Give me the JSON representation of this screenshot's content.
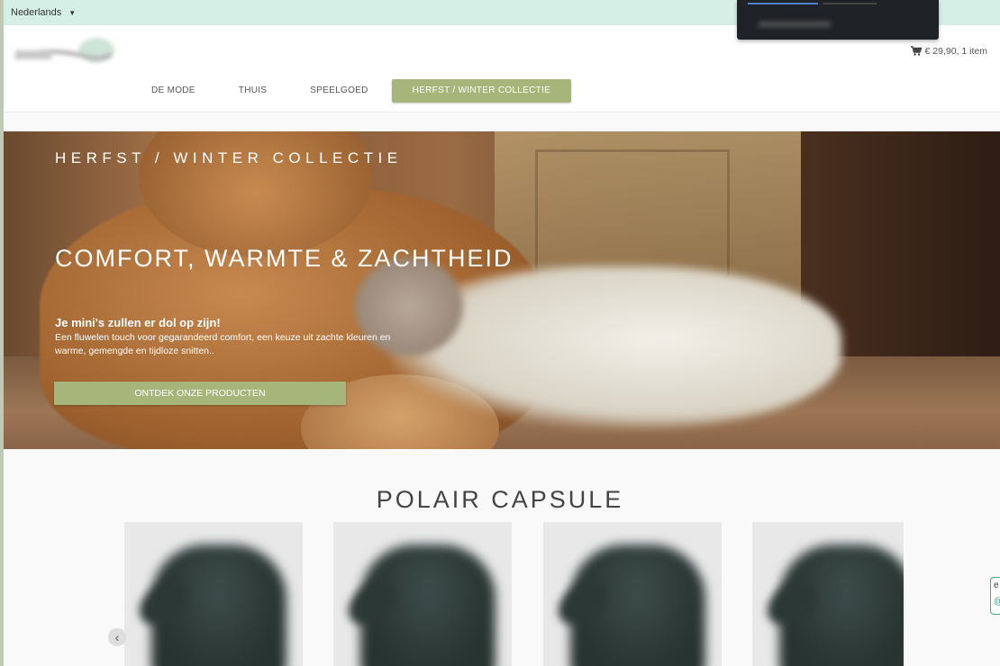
{
  "topbar": {
    "language": "Nederlands"
  },
  "header": {
    "cart_text": "€ 29,90, 1 item",
    "nav": [
      {
        "label": "DE MODE"
      },
      {
        "label": "THUIS"
      },
      {
        "label": "SPEELGOED"
      },
      {
        "label": "HERFST / WINTER COLLECTIE",
        "active": true
      }
    ]
  },
  "hero": {
    "subtitle": "HERFST / WINTER COLLECTIE",
    "title": "COMFORT, WARMTE & ZACHTHEID",
    "lead": "Je mini's zullen er dol op zijn!",
    "text": "Een fluwelen touch voor gegarandeerd comfort, een keuze uit zachte kleuren en warme, gemengde en tijdloze snitten..",
    "button": "ONTDEK ONZE PRODUCTEN"
  },
  "section": {
    "title": "POLAIR CAPSULE"
  },
  "products": [
    {
      "image": "polar-jacket"
    },
    {
      "image": "polar-jacket"
    },
    {
      "image": "polar-jacket"
    },
    {
      "image": "polar-jacket"
    }
  ],
  "colors": {
    "accent": "#a6b67a",
    "topbar": "#d6efe6"
  }
}
